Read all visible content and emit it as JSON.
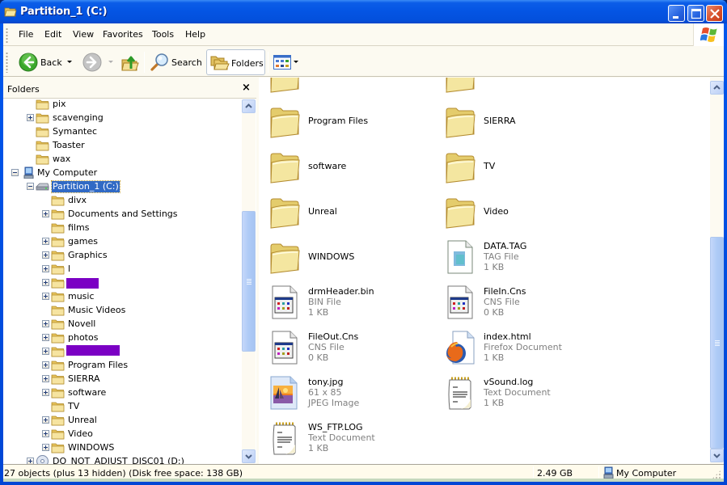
{
  "window": {
    "title": "Partition_1 (C:)",
    "controls": {
      "minimize": "Minimize",
      "maximize": "Maximize",
      "close": "Close"
    }
  },
  "menubar": {
    "items": [
      "File",
      "Edit",
      "View",
      "Favorites",
      "Tools",
      "Help"
    ]
  },
  "toolbar": {
    "back_label": "Back",
    "search_label": "Search",
    "folders_label": "Folders",
    "icons": [
      "back-icon",
      "forward-icon",
      "up-folder-icon",
      "search-icon",
      "folders-icon",
      "views-icon"
    ]
  },
  "folders_pane": {
    "title": "Folders",
    "close_glyph": "×",
    "tree": [
      {
        "label": "pix",
        "level": 1,
        "expander": "none",
        "icon": "folder"
      },
      {
        "label": "scavenging",
        "level": 1,
        "expander": "plus",
        "icon": "folder"
      },
      {
        "label": "Symantec",
        "level": 1,
        "expander": "none",
        "icon": "folder"
      },
      {
        "label": "Toaster",
        "level": 1,
        "expander": "none",
        "icon": "folder"
      },
      {
        "label": "wax",
        "level": 1,
        "expander": "none",
        "icon": "folder"
      },
      {
        "label": "My Computer",
        "level": 0,
        "expander": "minus",
        "icon": "computer"
      },
      {
        "label": "Partition_1 (C:)",
        "level": 1,
        "expander": "minus",
        "icon": "drive",
        "selected": true
      },
      {
        "label": "divx",
        "level": 2,
        "expander": "none",
        "icon": "folder"
      },
      {
        "label": "Documents and Settings",
        "level": 2,
        "expander": "plus",
        "icon": "folder"
      },
      {
        "label": "films",
        "level": 2,
        "expander": "none",
        "icon": "folder"
      },
      {
        "label": "games",
        "level": 2,
        "expander": "plus",
        "icon": "folder"
      },
      {
        "label": "Graphics",
        "level": 2,
        "expander": "plus",
        "icon": "folder"
      },
      {
        "label": "l",
        "level": 2,
        "expander": "plus",
        "icon": "folder"
      },
      {
        "label": "",
        "level": 2,
        "expander": "plus",
        "icon": "folder",
        "redacted": "short"
      },
      {
        "label": "music",
        "level": 2,
        "expander": "plus",
        "icon": "folder"
      },
      {
        "label": "Music Videos",
        "level": 2,
        "expander": "none",
        "icon": "folder"
      },
      {
        "label": "Novell",
        "level": 2,
        "expander": "plus",
        "icon": "folder"
      },
      {
        "label": "photos",
        "level": 2,
        "expander": "plus",
        "icon": "folder"
      },
      {
        "label": "",
        "level": 2,
        "expander": "plus",
        "icon": "folder",
        "redacted": "long"
      },
      {
        "label": "Program Files",
        "level": 2,
        "expander": "plus",
        "icon": "folder"
      },
      {
        "label": "SIERRA",
        "level": 2,
        "expander": "plus",
        "icon": "folder"
      },
      {
        "label": "software",
        "level": 2,
        "expander": "plus",
        "icon": "folder"
      },
      {
        "label": "TV",
        "level": 2,
        "expander": "none",
        "icon": "folder"
      },
      {
        "label": "Unreal",
        "level": 2,
        "expander": "plus",
        "icon": "folder"
      },
      {
        "label": "Video",
        "level": 2,
        "expander": "plus",
        "icon": "folder"
      },
      {
        "label": "WINDOWS",
        "level": 2,
        "expander": "plus",
        "icon": "folder"
      },
      {
        "label": "DO_NOT_ADJUST_DISC01 (D:)",
        "level": 1,
        "expander": "plus",
        "icon": "cd-drive"
      }
    ],
    "redact_color": "#7b00c4",
    "scroll_position": 0.5
  },
  "files": [
    {
      "name": "",
      "type": "",
      "size": "",
      "icon": "folder",
      "partial": true
    },
    {
      "name": "",
      "type": "",
      "size": "",
      "icon": "folder",
      "partial": true
    },
    {
      "name": "Program Files",
      "type": "",
      "size": "",
      "icon": "folder"
    },
    {
      "name": "SIERRA",
      "type": "",
      "size": "",
      "icon": "folder"
    },
    {
      "name": "software",
      "type": "",
      "size": "",
      "icon": "folder"
    },
    {
      "name": "TV",
      "type": "",
      "size": "",
      "icon": "folder"
    },
    {
      "name": "Unreal",
      "type": "",
      "size": "",
      "icon": "folder"
    },
    {
      "name": "Video",
      "type": "",
      "size": "",
      "icon": "folder"
    },
    {
      "name": "WINDOWS",
      "type": "",
      "size": "",
      "icon": "folder"
    },
    {
      "name": "DATA.TAG",
      "type": "TAG File",
      "size": "1 KB",
      "icon": "generic-file"
    },
    {
      "name": "drmHeader.bin",
      "type": "BIN File",
      "size": "1 KB",
      "icon": "app-file"
    },
    {
      "name": "FileIn.Cns",
      "type": "CNS File",
      "size": "0 KB",
      "icon": "app-file"
    },
    {
      "name": "FileOut.Cns",
      "type": "CNS File",
      "size": "0 KB",
      "icon": "app-file"
    },
    {
      "name": "index.html",
      "type": "Firefox Document",
      "size": "1 KB",
      "icon": "firefox-file"
    },
    {
      "name": "tony.jpg",
      "type": "61 x 85",
      "size": "JPEG Image",
      "icon": "image-file"
    },
    {
      "name": "vSound.log",
      "type": "Text Document",
      "size": "1 KB",
      "icon": "text-file"
    },
    {
      "name": "WS_FTP.LOG",
      "type": "Text Document",
      "size": "1 KB",
      "icon": "text-file"
    }
  ],
  "content_scroll_position": 1.0,
  "statusbar": {
    "summary": "27 objects (plus 13 hidden) (Disk free space: 138 GB)",
    "size": "2.49 GB",
    "zone": "My Computer"
  },
  "colors": {
    "title_blue": "#0454e3",
    "selection": "#316ac5",
    "folder_yellow": "#f0d878",
    "close_red": "#d8502c"
  }
}
